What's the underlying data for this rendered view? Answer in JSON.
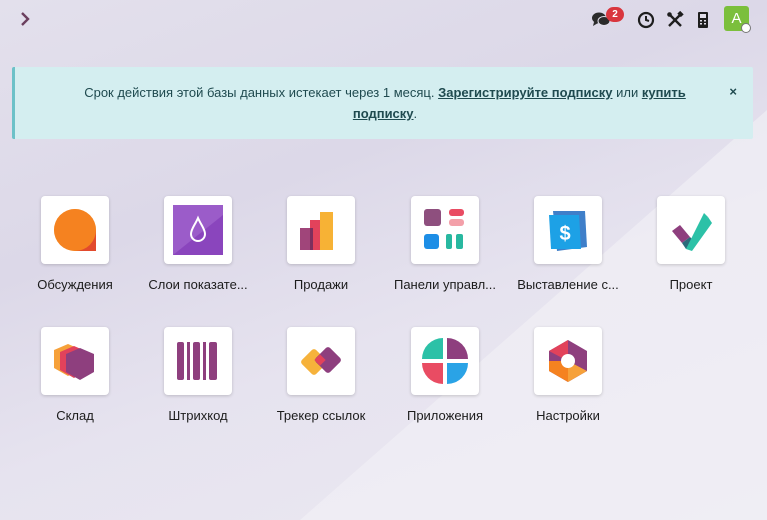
{
  "topbar": {
    "icons": [
      "chevron-right-icon",
      "chat-icon",
      "clock-icon",
      "tools-icon",
      "phone-icon"
    ],
    "message_count": "2",
    "avatar_letter": "A"
  },
  "banner": {
    "text": "Срок действия этой базы данных истекает через 1 месяц.",
    "register_link": "Зарегистрируйте подписку",
    "or_text": "или",
    "buy_link_1": "купить",
    "buy_link_2": "подписку",
    "end": ".",
    "close": "×"
  },
  "apps": [
    {
      "label": "Обсуждения",
      "icon": "discuss-icon"
    },
    {
      "label": "Слои показате...",
      "icon": "droplet-icon"
    },
    {
      "label": "Продажи",
      "icon": "sales-icon"
    },
    {
      "label": "Панели управл...",
      "icon": "dashboards-icon"
    },
    {
      "label": "Выставление с...",
      "icon": "invoicing-icon"
    },
    {
      "label": "Проект",
      "icon": "project-icon"
    },
    {
      "label": "Склад",
      "icon": "inventory-icon"
    },
    {
      "label": "Штрихкод",
      "icon": "barcode-icon"
    },
    {
      "label": "Трекер ссылок",
      "icon": "link-tracker-icon"
    },
    {
      "label": "Приложения",
      "icon": "apps-icon"
    },
    {
      "label": "Настройки",
      "icon": "settings-icon"
    }
  ]
}
